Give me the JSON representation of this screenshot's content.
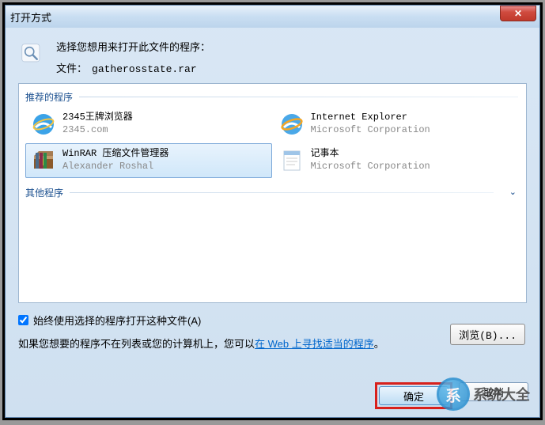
{
  "window": {
    "title": "打开方式",
    "close": "✕"
  },
  "header": {
    "prompt": "选择您想用来打开此文件的程序：",
    "file_label": "文件：",
    "file_name": "gatherosstate.rar"
  },
  "groups": {
    "recommended": "推荐的程序",
    "other": "其他程序"
  },
  "programs": [
    {
      "name": "2345王牌浏览器",
      "desc": "2345.com",
      "icon": "ie-blue"
    },
    {
      "name": "Internet Explorer",
      "desc": "Microsoft Corporation",
      "icon": "ie-gold"
    },
    {
      "name": "WinRAR 压缩文件管理器",
      "desc": "Alexander Roshal",
      "icon": "winrar",
      "selected": true
    },
    {
      "name": "记事本",
      "desc": "Microsoft Corporation",
      "icon": "notepad"
    }
  ],
  "checkbox": {
    "label": "始终使用选择的程序打开这种文件(A)",
    "checked": true
  },
  "browse_label": "浏览(B)...",
  "hint": {
    "text": "如果您想要的程序不在列表或您的计算机上，您可以",
    "link": "在 Web 上寻找适当的程序",
    "suffix": "。"
  },
  "buttons": {
    "ok": "确定",
    "cancel": "取消"
  },
  "watermark": {
    "text": "系统大全",
    "url": "www.xp85.com"
  }
}
